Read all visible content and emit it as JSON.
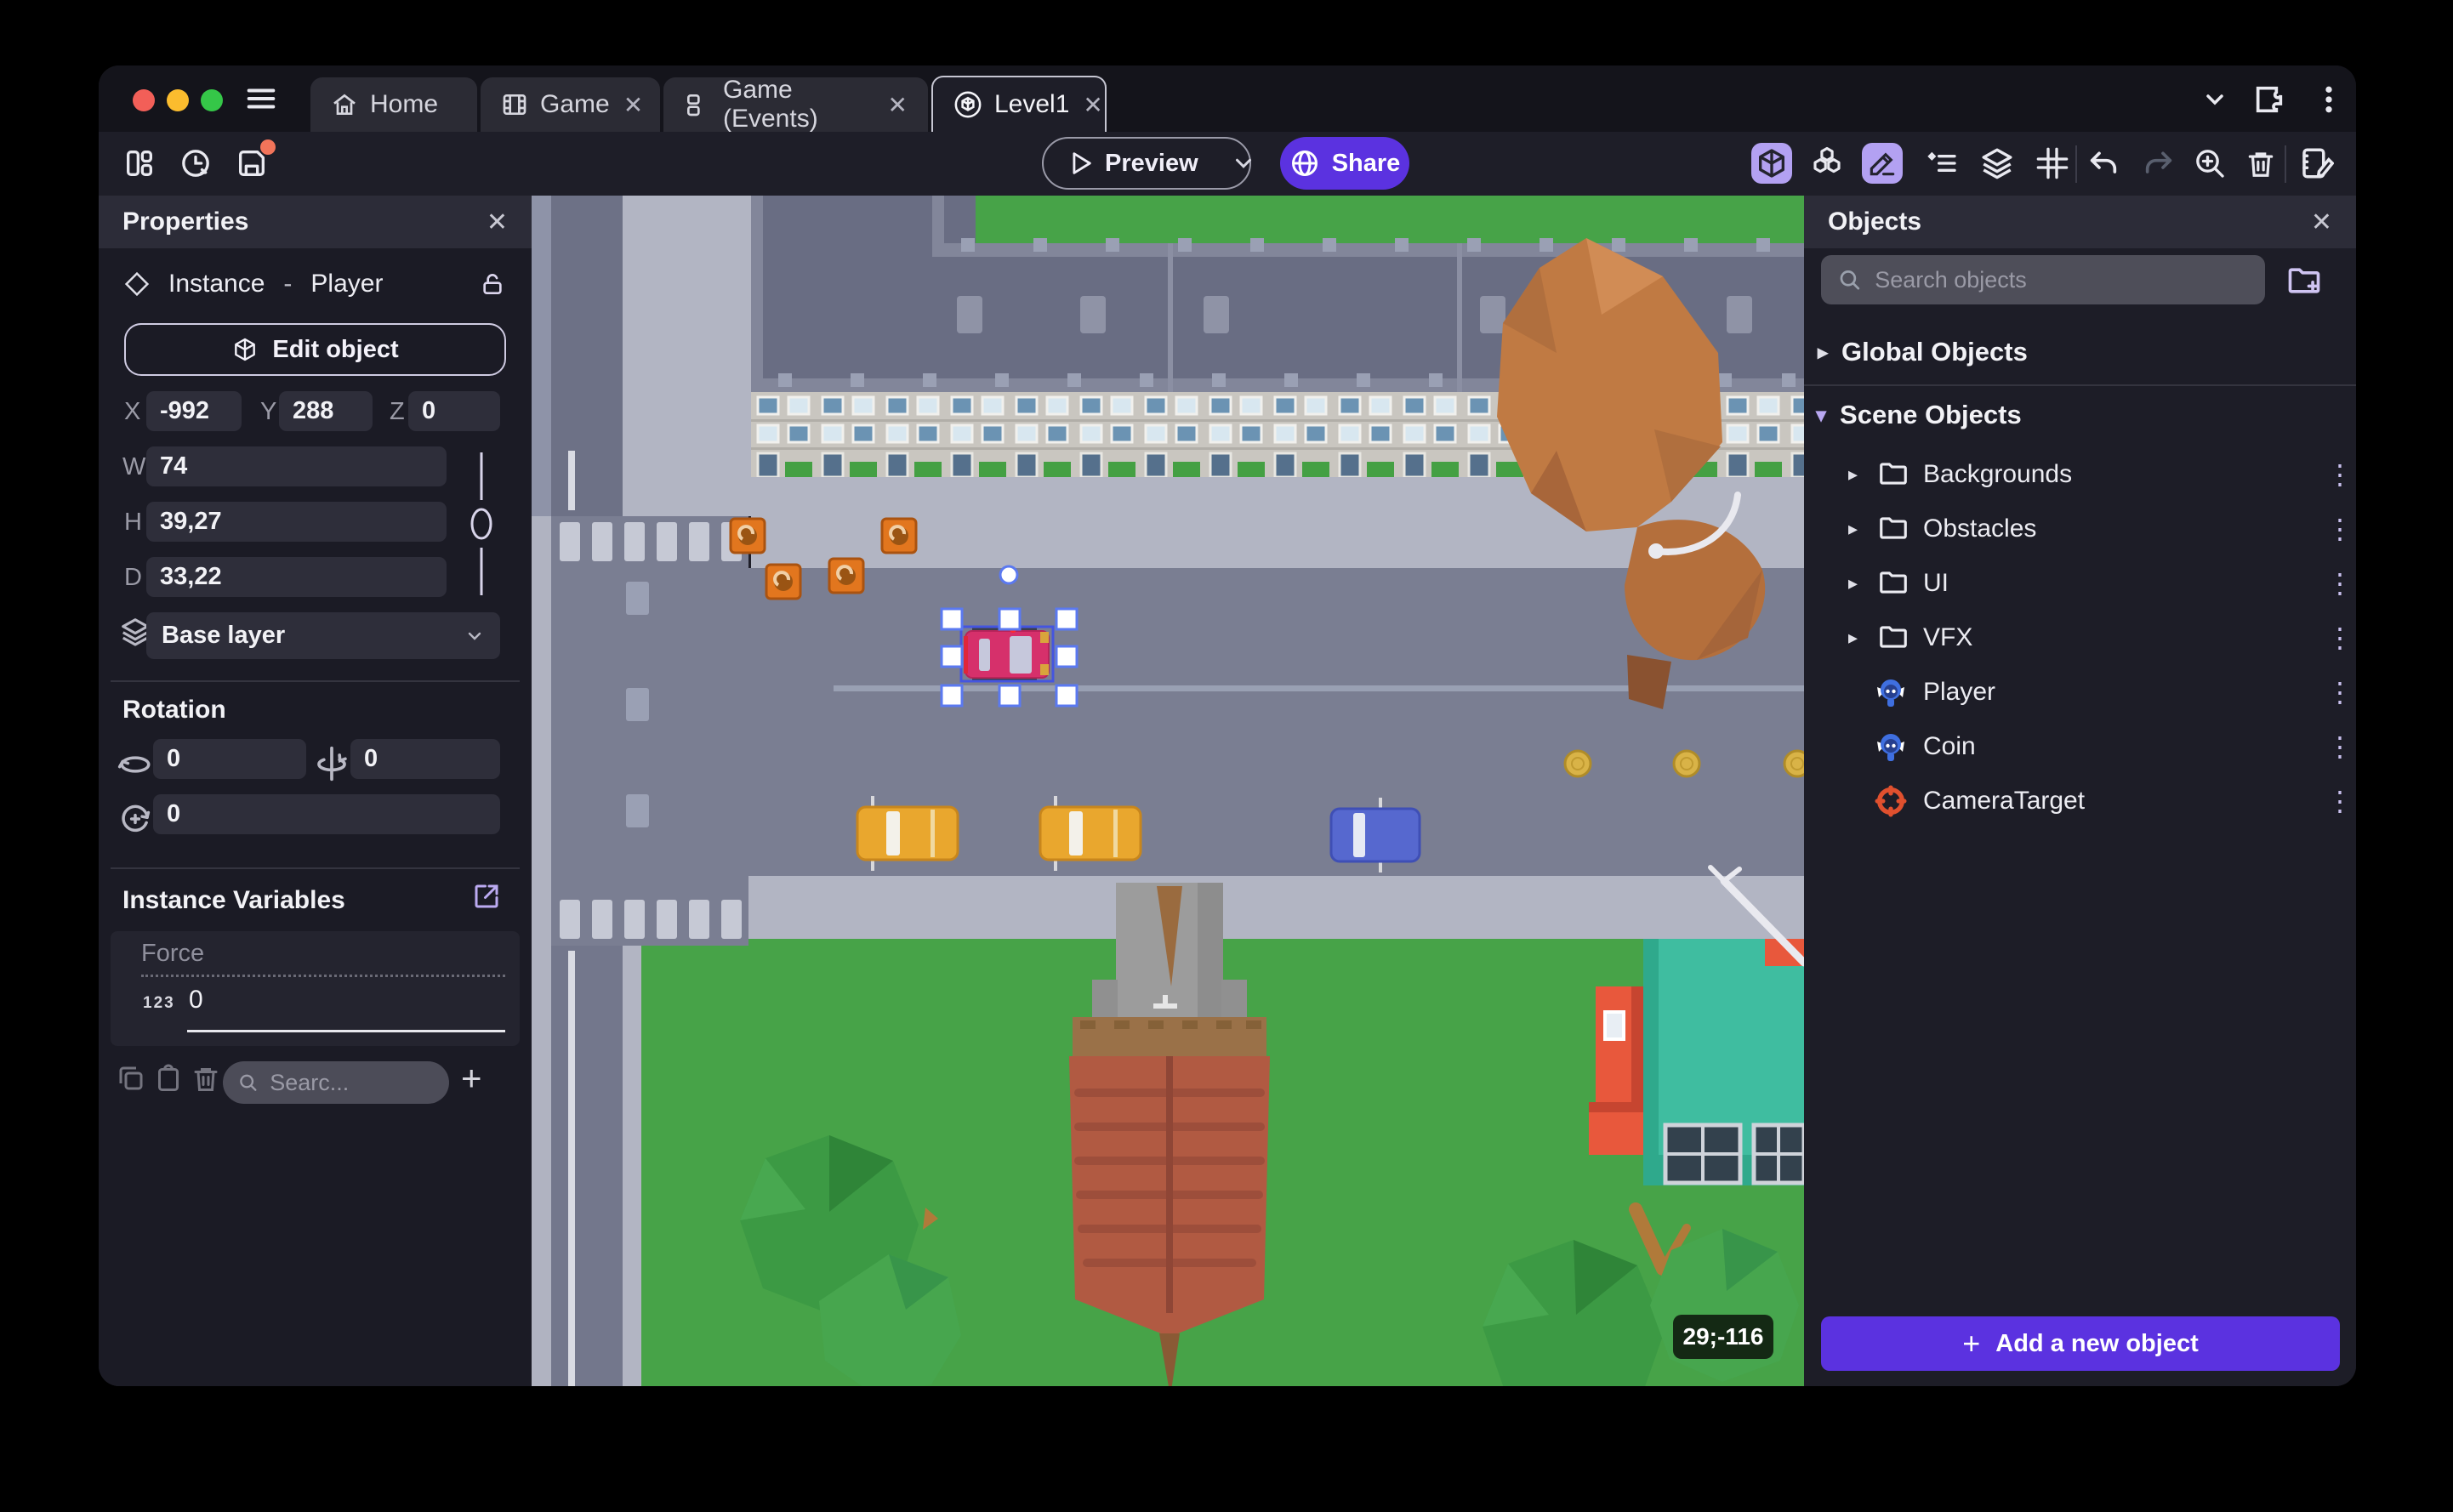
{
  "icons": {
    "close": "✕",
    "plus": "+",
    "kebab": "⋮",
    "caret_right": "▸",
    "caret_down": "▾",
    "dash": "-"
  },
  "tabs": {
    "home": "Home",
    "game": "Game",
    "game_events": "Game (Events)",
    "level1": "Level1"
  },
  "toolbar": {
    "preview": "Preview",
    "share": "Share"
  },
  "properties": {
    "title": "Properties",
    "instance_type": "Instance",
    "separator": "-",
    "instance_name": "Player",
    "edit_object": "Edit object",
    "x_label": "X",
    "x_value": "-992",
    "y_label": "Y",
    "y_value": "288",
    "z_label": "Z",
    "z_value": "0",
    "w_label": "W",
    "w_value": "74",
    "h_label": "H",
    "h_value": "39,27",
    "d_label": "D",
    "d_value": "33,22",
    "layer_value": "Base layer",
    "rotation_title": "Rotation",
    "rot_x": "0",
    "rot_y": "0",
    "rot_z": "0",
    "variables_title": "Instance Variables",
    "variable_name": "Force",
    "variable_type_badge": "123",
    "variable_value": "0",
    "search_placeholder": "Searc..."
  },
  "objects": {
    "title": "Objects",
    "search_placeholder": "Search objects",
    "global_group": "Global Objects",
    "scene_group": "Scene Objects",
    "items": [
      {
        "label": "Backgrounds",
        "type": "folder"
      },
      {
        "label": "Obstacles",
        "type": "folder"
      },
      {
        "label": "UI",
        "type": "folder"
      },
      {
        "label": "VFX",
        "type": "folder"
      },
      {
        "label": "Player",
        "type": "sprite"
      },
      {
        "label": "Coin",
        "type": "sprite"
      },
      {
        "label": "CameraTarget",
        "type": "target"
      }
    ],
    "add_button": "Add a new object"
  },
  "scene": {
    "coords_badge": "29;-116"
  },
  "colors": {
    "accent_purple": "#5b32e0",
    "active_tool": "#b3a1f2",
    "unsaved_dot": "#f2745a"
  }
}
